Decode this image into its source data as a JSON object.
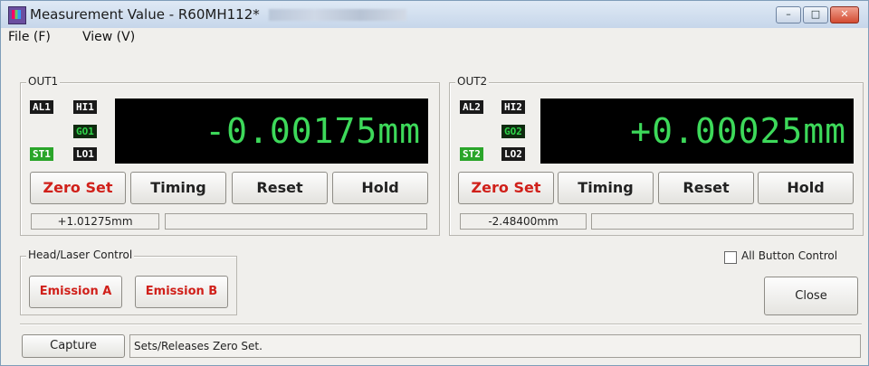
{
  "window": {
    "title": "Measurement Value - R60MH112*",
    "controls": {
      "minimize": "–",
      "maximize": "□",
      "close": "✕"
    }
  },
  "menu": {
    "file": "File (F)",
    "view": "View (V)"
  },
  "out1": {
    "label": "OUT1",
    "tags": {
      "al": "AL1",
      "hi": "HI1",
      "go": "GO1",
      "st": "ST1",
      "lo": "LO1"
    },
    "value": "-0.00175mm",
    "buttons": {
      "zero_set": "Zero Set",
      "timing": "Timing",
      "reset": "Reset",
      "hold": "Hold"
    },
    "sub_value": "+1.01275mm",
    "sub_field": ""
  },
  "out2": {
    "label": "OUT2",
    "tags": {
      "al": "AL2",
      "hi": "HI2",
      "go": "GO2",
      "st": "ST2",
      "lo": "LO2"
    },
    "value": "+0.00025mm",
    "buttons": {
      "zero_set": "Zero Set",
      "timing": "Timing",
      "reset": "Reset",
      "hold": "Hold"
    },
    "sub_value": "-2.48400mm",
    "sub_field": ""
  },
  "head_laser": {
    "label": "Head/Laser Control",
    "emission_a": "Emission A",
    "emission_b": "Emission B"
  },
  "all_button_control": {
    "label": "All Button Control",
    "checked": false
  },
  "close_button": "Close",
  "capture_button": "Capture",
  "status_text": "Sets/Releases Zero Set.",
  "colors": {
    "digits": "#3dd95a",
    "zero_set_text": "#d0201a",
    "display_bg": "#000000"
  }
}
